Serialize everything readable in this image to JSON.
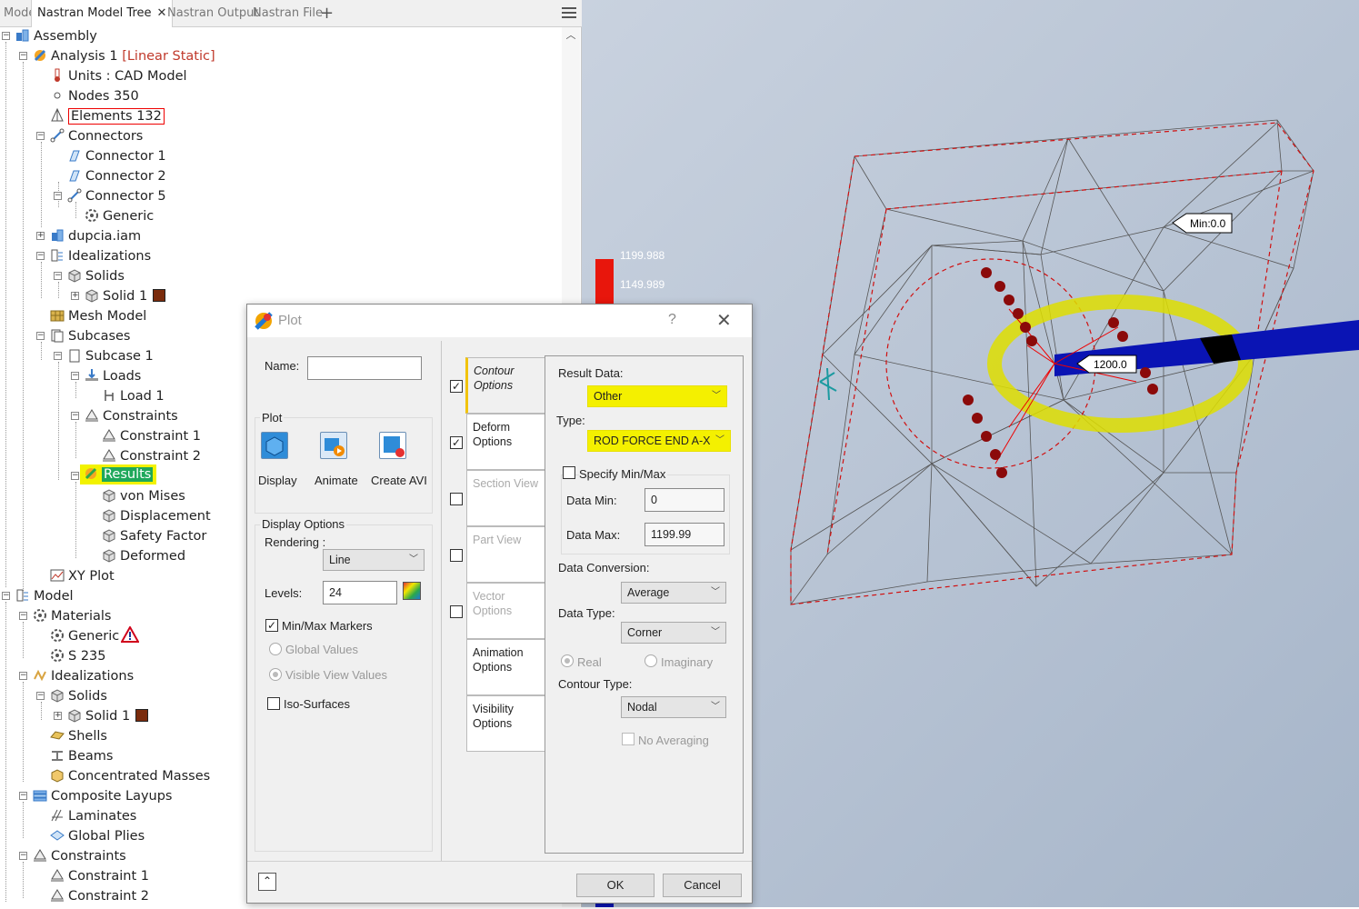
{
  "tabs": [
    {
      "label": "Model",
      "active": false
    },
    {
      "label": "Nastran Model Tree",
      "active": true
    },
    {
      "label": "Nastran Output",
      "active": false
    },
    {
      "label": "Nastran File",
      "active": false
    }
  ],
  "tree": {
    "assembly": "Assembly",
    "analysis": "Analysis 1",
    "analysis_type": "[Linear Static]",
    "units": "Units : CAD Model",
    "nodes": "Nodes 350",
    "elements": "Elements 132",
    "connectors": "Connectors",
    "connector1": "Connector 1",
    "connector2": "Connector 2",
    "connector5": "Connector 5",
    "generic": "Generic",
    "dupcia": "dupcia.iam",
    "idealizations": "Idealizations",
    "solids": "Solids",
    "solid1": "Solid 1",
    "mesh_model": "Mesh Model",
    "subcases": "Subcases",
    "subcase1": "Subcase 1",
    "loads": "Loads",
    "load1": "Load 1",
    "constraints": "Constraints",
    "constraint1": "Constraint 1",
    "constraint2": "Constraint 2",
    "results": "Results",
    "von_mises": "von Mises",
    "displacement": "Displacement",
    "safety_factor": "Safety Factor",
    "deformed": "Deformed",
    "xy_plot": "XY Plot",
    "model": "Model",
    "materials": "Materials",
    "mat_generic": "Generic",
    "s235": "S 235",
    "m_idealizations": "Idealizations",
    "m_solids": "Solids",
    "m_solid1": "Solid 1",
    "shells": "Shells",
    "beams": "Beams",
    "conc_masses": "Concentrated Masses",
    "composite": "Composite Layups",
    "laminates": "Laminates",
    "global_plies": "Global Plies",
    "m_constraints": "Constraints",
    "m_constraint1": "Constraint 1",
    "m_constraint2": "Constraint 2"
  },
  "viewport": {
    "legend_max": "1199.988",
    "legend_next": "1149.989",
    "min_label": "Min:0.0",
    "max_label": "1200.0"
  },
  "dialog": {
    "title": "Plot",
    "help": "?",
    "name_label": "Name:",
    "name_value": "",
    "plot_group": "Plot",
    "display": "Display",
    "animate": "Animate",
    "create_avi": "Create AVI",
    "display_options": "Display Options",
    "rendering_label": "Rendering :",
    "rendering_value": "Line",
    "levels_label": "Levels:",
    "levels_value": "24",
    "minmax_markers": "Min/Max Markers",
    "global_values": "Global Values",
    "visible_view_values": "Visible View Values",
    "iso_surfaces": "Iso-Surfaces",
    "tab_contour": "Contour Options",
    "tab_deform": "Deform Options",
    "tab_section": "Section View",
    "tab_part": "Part View",
    "tab_vector": "Vector Options",
    "tab_animation": "Animation Options",
    "tab_visibility": "Visibility Options",
    "result_data_label": "Result Data:",
    "result_data_value": "Other",
    "type_label": "Type:",
    "type_value": "ROD FORCE END A-X",
    "specify_minmax": "Specify Min/Max",
    "data_min_label": "Data Min:",
    "data_min_value": "0",
    "data_max_label": "Data Max:",
    "data_max_value": "1199.99",
    "data_conversion_label": "Data Conversion:",
    "data_conversion_value": "Average",
    "data_type_label": "Data Type:",
    "data_type_value": "Corner",
    "real": "Real",
    "imaginary": "Imaginary",
    "contour_type_label": "Contour Type:",
    "contour_type_value": "Nodal",
    "no_averaging": "No Averaging",
    "ok": "OK",
    "cancel": "Cancel"
  },
  "colors": {
    "highlight": "#f2f200",
    "beam": "#0a14b4",
    "legend_red": "#e8160c",
    "arrow": "#8b0a0a"
  }
}
